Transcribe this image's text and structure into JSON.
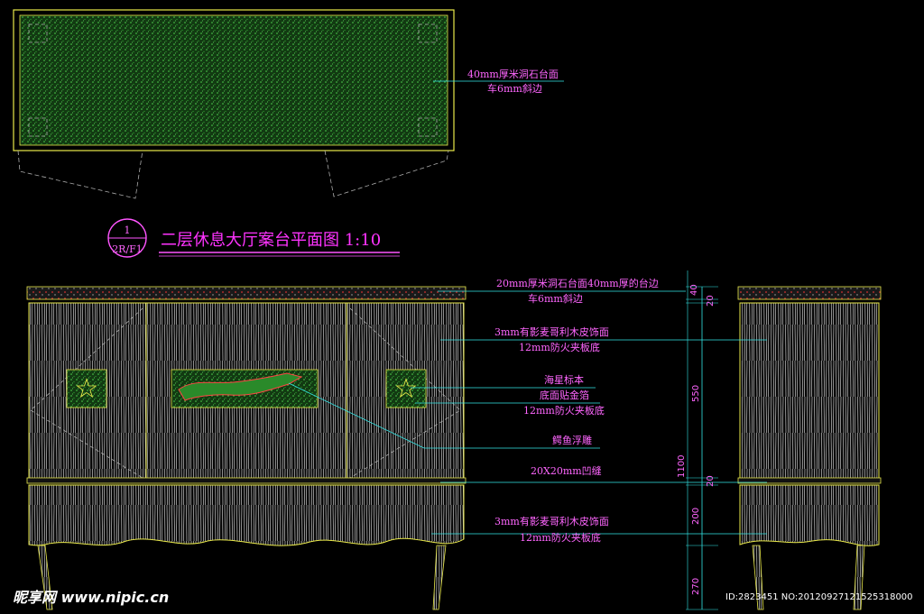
{
  "plan": {
    "annotation_top_line1": "40mm厚米洞石台面",
    "annotation_top_line2": "车6mm斜边"
  },
  "title_block": {
    "symbol_top": "1",
    "symbol_bottom": "2R/F1",
    "title": "二层休息大厅案台平面图 1:10"
  },
  "elevation_notes": [
    "20mm厚米洞石台面40mm厚的台边",
    "车6mm斜边",
    "3mm有影麦哥利木皮饰面",
    "12mm防火夹板底",
    "海星标本",
    "底面贴金箔",
    "12mm防火夹板底",
    "鳄鱼浮雕",
    "20X20mm凹缝",
    "3mm有影麦哥利木皮饰面",
    "12mm防火夹板底"
  ],
  "dimensions": [
    "40",
    "20",
    "550",
    "20",
    "1100",
    "200",
    "270"
  ],
  "watermark": {
    "logo": "昵享网 www.nipic.cn",
    "id_text": "ID:2823451 NO:20120927121525318000"
  },
  "colors": {
    "outline": "#e8e84a",
    "hatch": "#2e8a2e",
    "text": "#ff55ff",
    "leader": "#33e6e6"
  }
}
